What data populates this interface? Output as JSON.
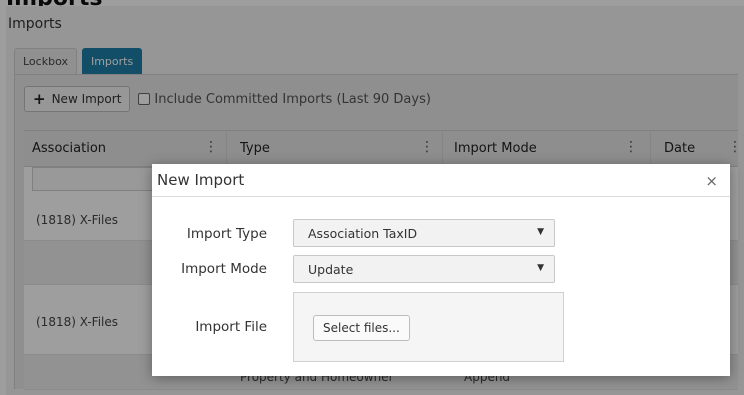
{
  "page": {
    "cut_heading": "Imports",
    "title": "Imports"
  },
  "tabs": [
    {
      "label": "Lockbox",
      "active": false
    },
    {
      "label": "Imports",
      "active": true
    }
  ],
  "toolbar": {
    "new_import_label": "New Import",
    "include_committed_label": "Include Committed Imports (Last 90 Days)",
    "include_committed_checked": false
  },
  "grid": {
    "columns": [
      "Association",
      "Type",
      "Import Mode",
      "Date"
    ],
    "rows": [
      {
        "association": "(1818) X-Files",
        "type": "",
        "mode": ""
      },
      {
        "association": "",
        "type": "",
        "mode": ""
      },
      {
        "association": "(1818) X-Files",
        "type": "",
        "mode": ""
      },
      {
        "association": "",
        "type": "Property and Homeowner",
        "mode": "Append"
      }
    ]
  },
  "modal": {
    "title": "New Import",
    "close_symbol": "×",
    "import_type_label": "Import Type",
    "import_type_value": "Association TaxID",
    "import_mode_label": "Import Mode",
    "import_mode_value": "Update",
    "import_file_label": "Import File",
    "select_files_label": "Select files...",
    "dropdown_arrow": "▼"
  },
  "colors": {
    "active_tab": "#1e7fa6",
    "overlay": "rgba(0,0,0,0.38)"
  }
}
